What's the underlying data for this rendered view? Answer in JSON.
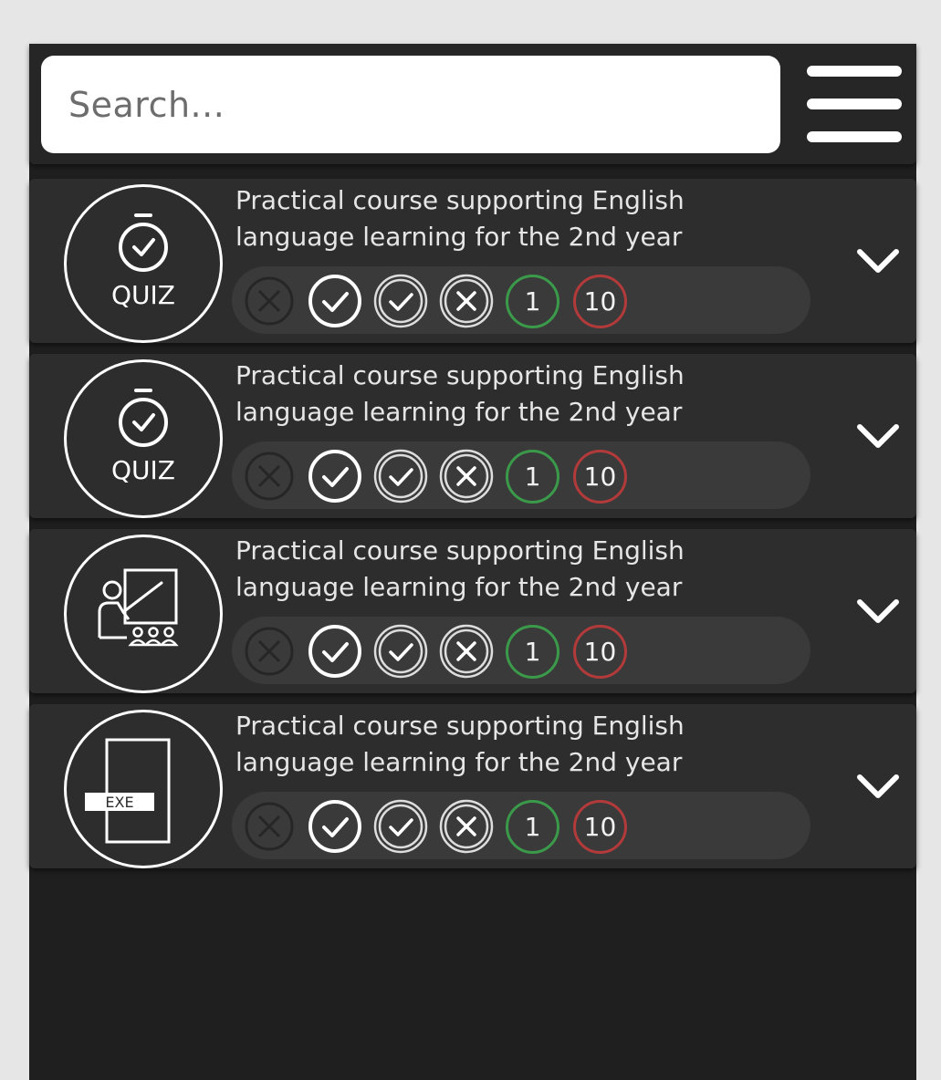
{
  "search": {
    "placeholder": "Search..."
  },
  "colors": {
    "background": "#e6e6e6",
    "panel": "#1f1f1f",
    "card": "#2d2d2d",
    "pill": "#3a3a3a",
    "correct_count": "#3a9a4a",
    "incorrect_count": "#b23a3a"
  },
  "items": [
    {
      "type_icon": "quiz-stopwatch-icon",
      "type_label": "QUIZ",
      "title_line1": "Practical course supporting English",
      "title_line2": "language learning for the 2nd year",
      "statuses": [
        "cross-dim-icon",
        "check-icon",
        "check-double-ring-icon",
        "cross-double-ring-icon"
      ],
      "correct_count": "1",
      "incorrect_count": "10"
    },
    {
      "type_icon": "quiz-stopwatch-icon",
      "type_label": "QUIZ",
      "title_line1": "Practical course supporting English",
      "title_line2": "language learning for the 2nd year",
      "statuses": [
        "cross-dim-icon",
        "check-icon",
        "check-double-ring-icon",
        "cross-double-ring-icon"
      ],
      "correct_count": "1",
      "incorrect_count": "10"
    },
    {
      "type_icon": "lecture-teacher-icon",
      "type_label": "",
      "title_line1": "Practical course supporting English",
      "title_line2": "language learning for the 2nd year",
      "statuses": [
        "cross-dim-icon",
        "check-icon",
        "check-double-ring-icon",
        "cross-double-ring-icon"
      ],
      "correct_count": "1",
      "incorrect_count": "10"
    },
    {
      "type_icon": "exe-file-icon",
      "type_label": "EXE",
      "title_line1": "Practical course supporting English",
      "title_line2": "language learning for the 2nd year",
      "statuses": [
        "cross-dim-icon",
        "check-icon",
        "check-double-ring-icon",
        "cross-double-ring-icon"
      ],
      "correct_count": "1",
      "incorrect_count": "10"
    }
  ]
}
